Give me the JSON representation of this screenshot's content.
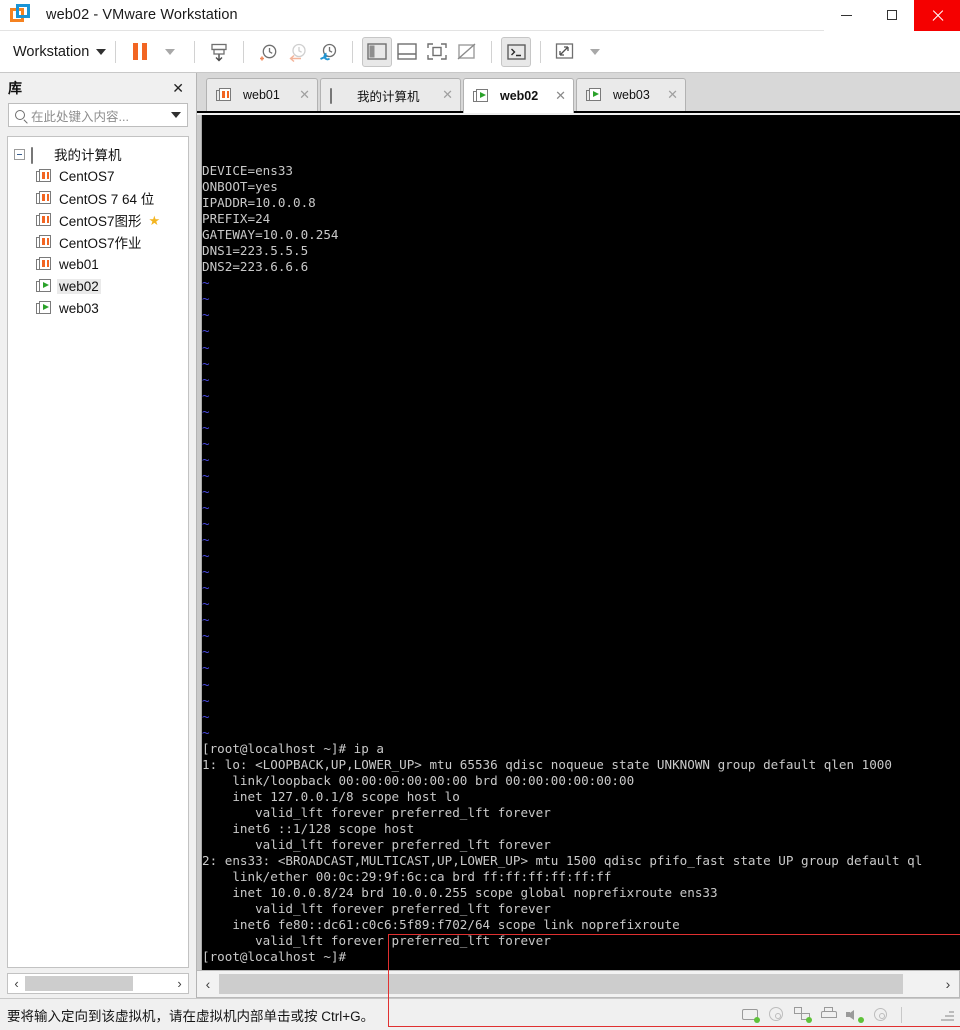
{
  "window": {
    "title": "web02 - VMware Workstation",
    "logo_icon": "vmware-logo-icon",
    "minimize_label": "─",
    "maximize_label": "□",
    "close_label": "✕"
  },
  "toolbar": {
    "menu_label": "Workstation",
    "items": [
      {
        "name": "pause-vm-button",
        "icon": "pause-icon"
      },
      {
        "name": "pause-dropdown-button",
        "icon": "chevron-down-icon"
      },
      {
        "name": "manage-snapshot-button",
        "icon": "snapshot-save-icon"
      },
      {
        "name": "take-snapshot-button",
        "icon": "clock-plus-icon"
      },
      {
        "name": "revert-snapshot-button",
        "icon": "clock-back-icon"
      },
      {
        "name": "snapshot-manager-button",
        "icon": "clock-wrench-icon"
      },
      {
        "name": "show-library-button",
        "icon": "panel-left-icon"
      },
      {
        "name": "show-thumbnails-button",
        "icon": "panel-bottom-icon"
      },
      {
        "name": "fullscreen-button",
        "icon": "fullscreen-icon"
      },
      {
        "name": "unity-mode-button",
        "icon": "unity-off-icon"
      },
      {
        "name": "console-view-button",
        "icon": "terminal-prompt-icon"
      },
      {
        "name": "stretch-view-button",
        "icon": "expand-diagonal-icon"
      },
      {
        "name": "stretch-dropdown-button",
        "icon": "chevron-down-icon"
      }
    ]
  },
  "library": {
    "title": "库",
    "close_label": "✕",
    "search": {
      "placeholder": "在此处键入内容...",
      "value": ""
    },
    "root": {
      "label": "我的计算机",
      "icon": "monitor-icon"
    },
    "items": [
      {
        "label": "CentOS7",
        "state": "paused",
        "favorite": false,
        "selected": false
      },
      {
        "label": "CentOS 7 64 位",
        "state": "paused",
        "favorite": false,
        "selected": false
      },
      {
        "label": "CentOS7图形",
        "state": "paused",
        "favorite": true,
        "selected": false
      },
      {
        "label": "CentOS7作业",
        "state": "paused",
        "favorite": false,
        "selected": false
      },
      {
        "label": "web01",
        "state": "paused",
        "favorite": false,
        "selected": false
      },
      {
        "label": "web02",
        "state": "running",
        "favorite": false,
        "selected": true
      },
      {
        "label": "web03",
        "state": "running",
        "favorite": false,
        "selected": false
      }
    ]
  },
  "tabs": [
    {
      "label": "web01",
      "state": "paused",
      "active": false,
      "close_label": "✕"
    },
    {
      "label": "我的计算机",
      "state": "home",
      "active": false,
      "close_label": "✕"
    },
    {
      "label": "web02",
      "state": "running",
      "active": true,
      "close_label": "✕"
    },
    {
      "label": "web03",
      "state": "running",
      "active": false,
      "close_label": "✕"
    }
  ],
  "terminal": {
    "config_lines": [
      "DEVICE=ens33",
      "ONBOOT=yes",
      "IPADDR=10.0.0.8",
      "PREFIX=24",
      "GATEWAY=10.0.0.254",
      "DNS1=223.5.5.5",
      "DNS2=223.6.6.6"
    ],
    "tilde_glyph": "~",
    "tilde_count": 29,
    "output_lines": [
      "[root@localhost ~]# ip a",
      "1: lo: <LOOPBACK,UP,LOWER_UP> mtu 65536 qdisc noqueue state UNKNOWN group default qlen 1000",
      "    link/loopback 00:00:00:00:00:00 brd 00:00:00:00:00:00",
      "    inet 127.0.0.1/8 scope host lo",
      "       valid_lft forever preferred_lft forever",
      "    inet6 ::1/128 scope host",
      "       valid_lft forever preferred_lft forever",
      "2: ens33: <BROADCAST,MULTICAST,UP,LOWER_UP> mtu 1500 qdisc pfifo_fast state UP group default ql",
      "    link/ether 00:0c:29:9f:6c:ca brd ff:ff:ff:ff:ff:ff",
      "    inet 10.0.0.8/24 brd 10.0.0.255 scope global noprefixroute ens33",
      "       valid_lft forever preferred_lft forever",
      "    inet6 fe80::dc61:c0c6:5f89:f702/64 scope link noprefixroute",
      "       valid_lft forever preferred_lft forever",
      "[root@localhost ~]#"
    ],
    "highlight_color": "#e03030",
    "bg_color": "#000000",
    "fg_color": "#c9c9c9",
    "tilde_color": "#4848dd"
  },
  "scrollbars": {
    "left_arrow": "‹",
    "right_arrow": "›"
  },
  "statusbar": {
    "message": "要将输入定向到该虚拟机，请在虚拟机内部单击或按 Ctrl+G。",
    "devices": [
      {
        "name": "hard-disk-icon",
        "active": true
      },
      {
        "name": "cd-dvd-icon",
        "active": false
      },
      {
        "name": "network-adapter-icon",
        "active": true
      },
      {
        "name": "printer-icon",
        "active": false
      },
      {
        "name": "sound-card-icon",
        "active": true
      },
      {
        "name": "usb-controller-icon",
        "active": false
      },
      {
        "name": "notes-icon",
        "active": false
      }
    ]
  }
}
